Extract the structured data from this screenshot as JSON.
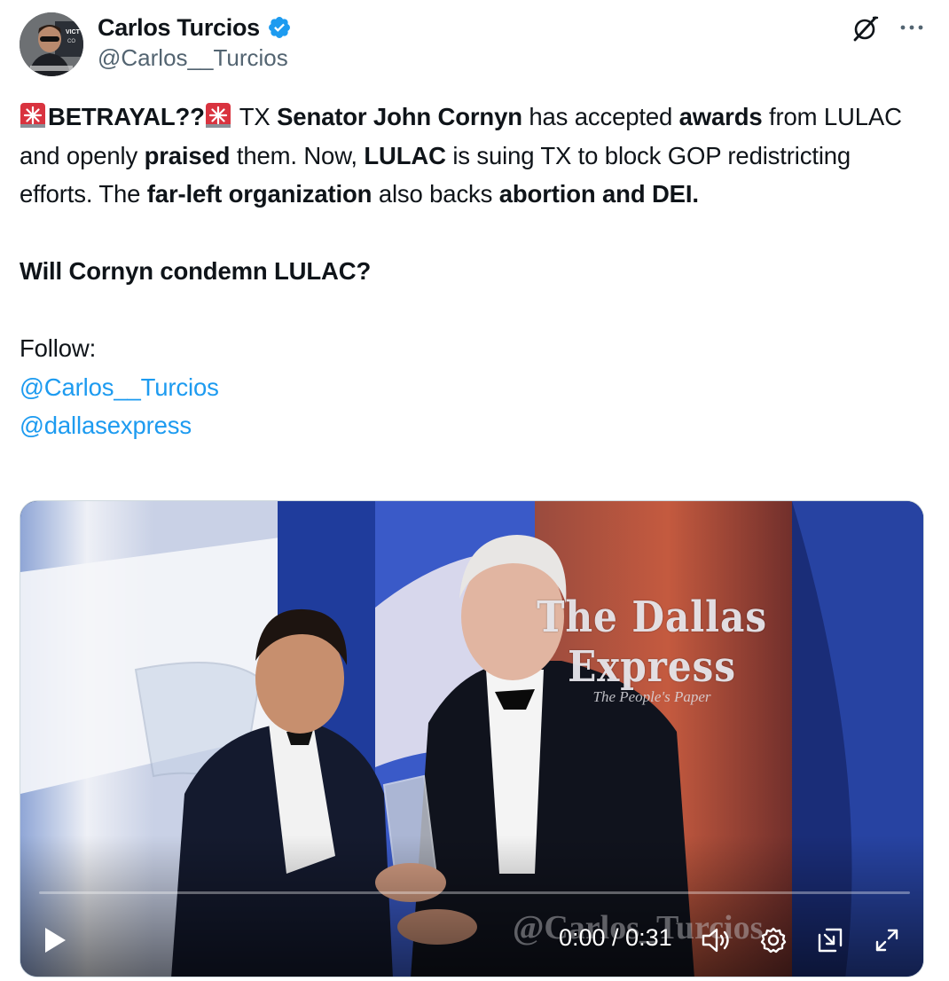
{
  "author": {
    "display_name": "Carlos Turcios",
    "handle": "@Carlos__Turcios",
    "verified": true
  },
  "icons": {
    "verified": "verified-badge-icon",
    "grok": "grok-icon",
    "more": "more-icon",
    "siren": "police-siren-emoji",
    "play": "play-icon",
    "volume": "volume-icon",
    "settings": "settings-gear-icon",
    "pip": "picture-in-picture-icon",
    "fullscreen": "fullscreen-icon"
  },
  "tweet": {
    "p1": {
      "t1": "BETRAYAL??",
      "t2": " TX ",
      "t3": "Senator John Cornyn",
      "t4": " has accepted ",
      "t5": "awards",
      "t6": " from LULAC and openly ",
      "t7": "praised",
      "t8": " them. Now, ",
      "t9": "LULAC",
      "t10": " is suing TX to block GOP redistricting efforts. The ",
      "t11": "far-left organization",
      "t12": " also backs ",
      "t13": "abortion and DEI."
    },
    "p2": "Will Cornyn condemn LULAC?",
    "follow_label": "Follow:",
    "mentions": [
      "@Carlos__Turcios",
      "@dallasexpress"
    ]
  },
  "video": {
    "watermark_title": "The Dallas Express",
    "watermark_subtitle": "The People's Paper",
    "watermark_handle": "@Carlos_Turcios",
    "current_time": "0:00",
    "duration": "0:31",
    "time_display": "0:00 / 0:31",
    "progress": 0.0
  },
  "colors": {
    "link": "#1d9bf0",
    "verified": "#1d9bf0",
    "secondary_text": "#536471"
  }
}
